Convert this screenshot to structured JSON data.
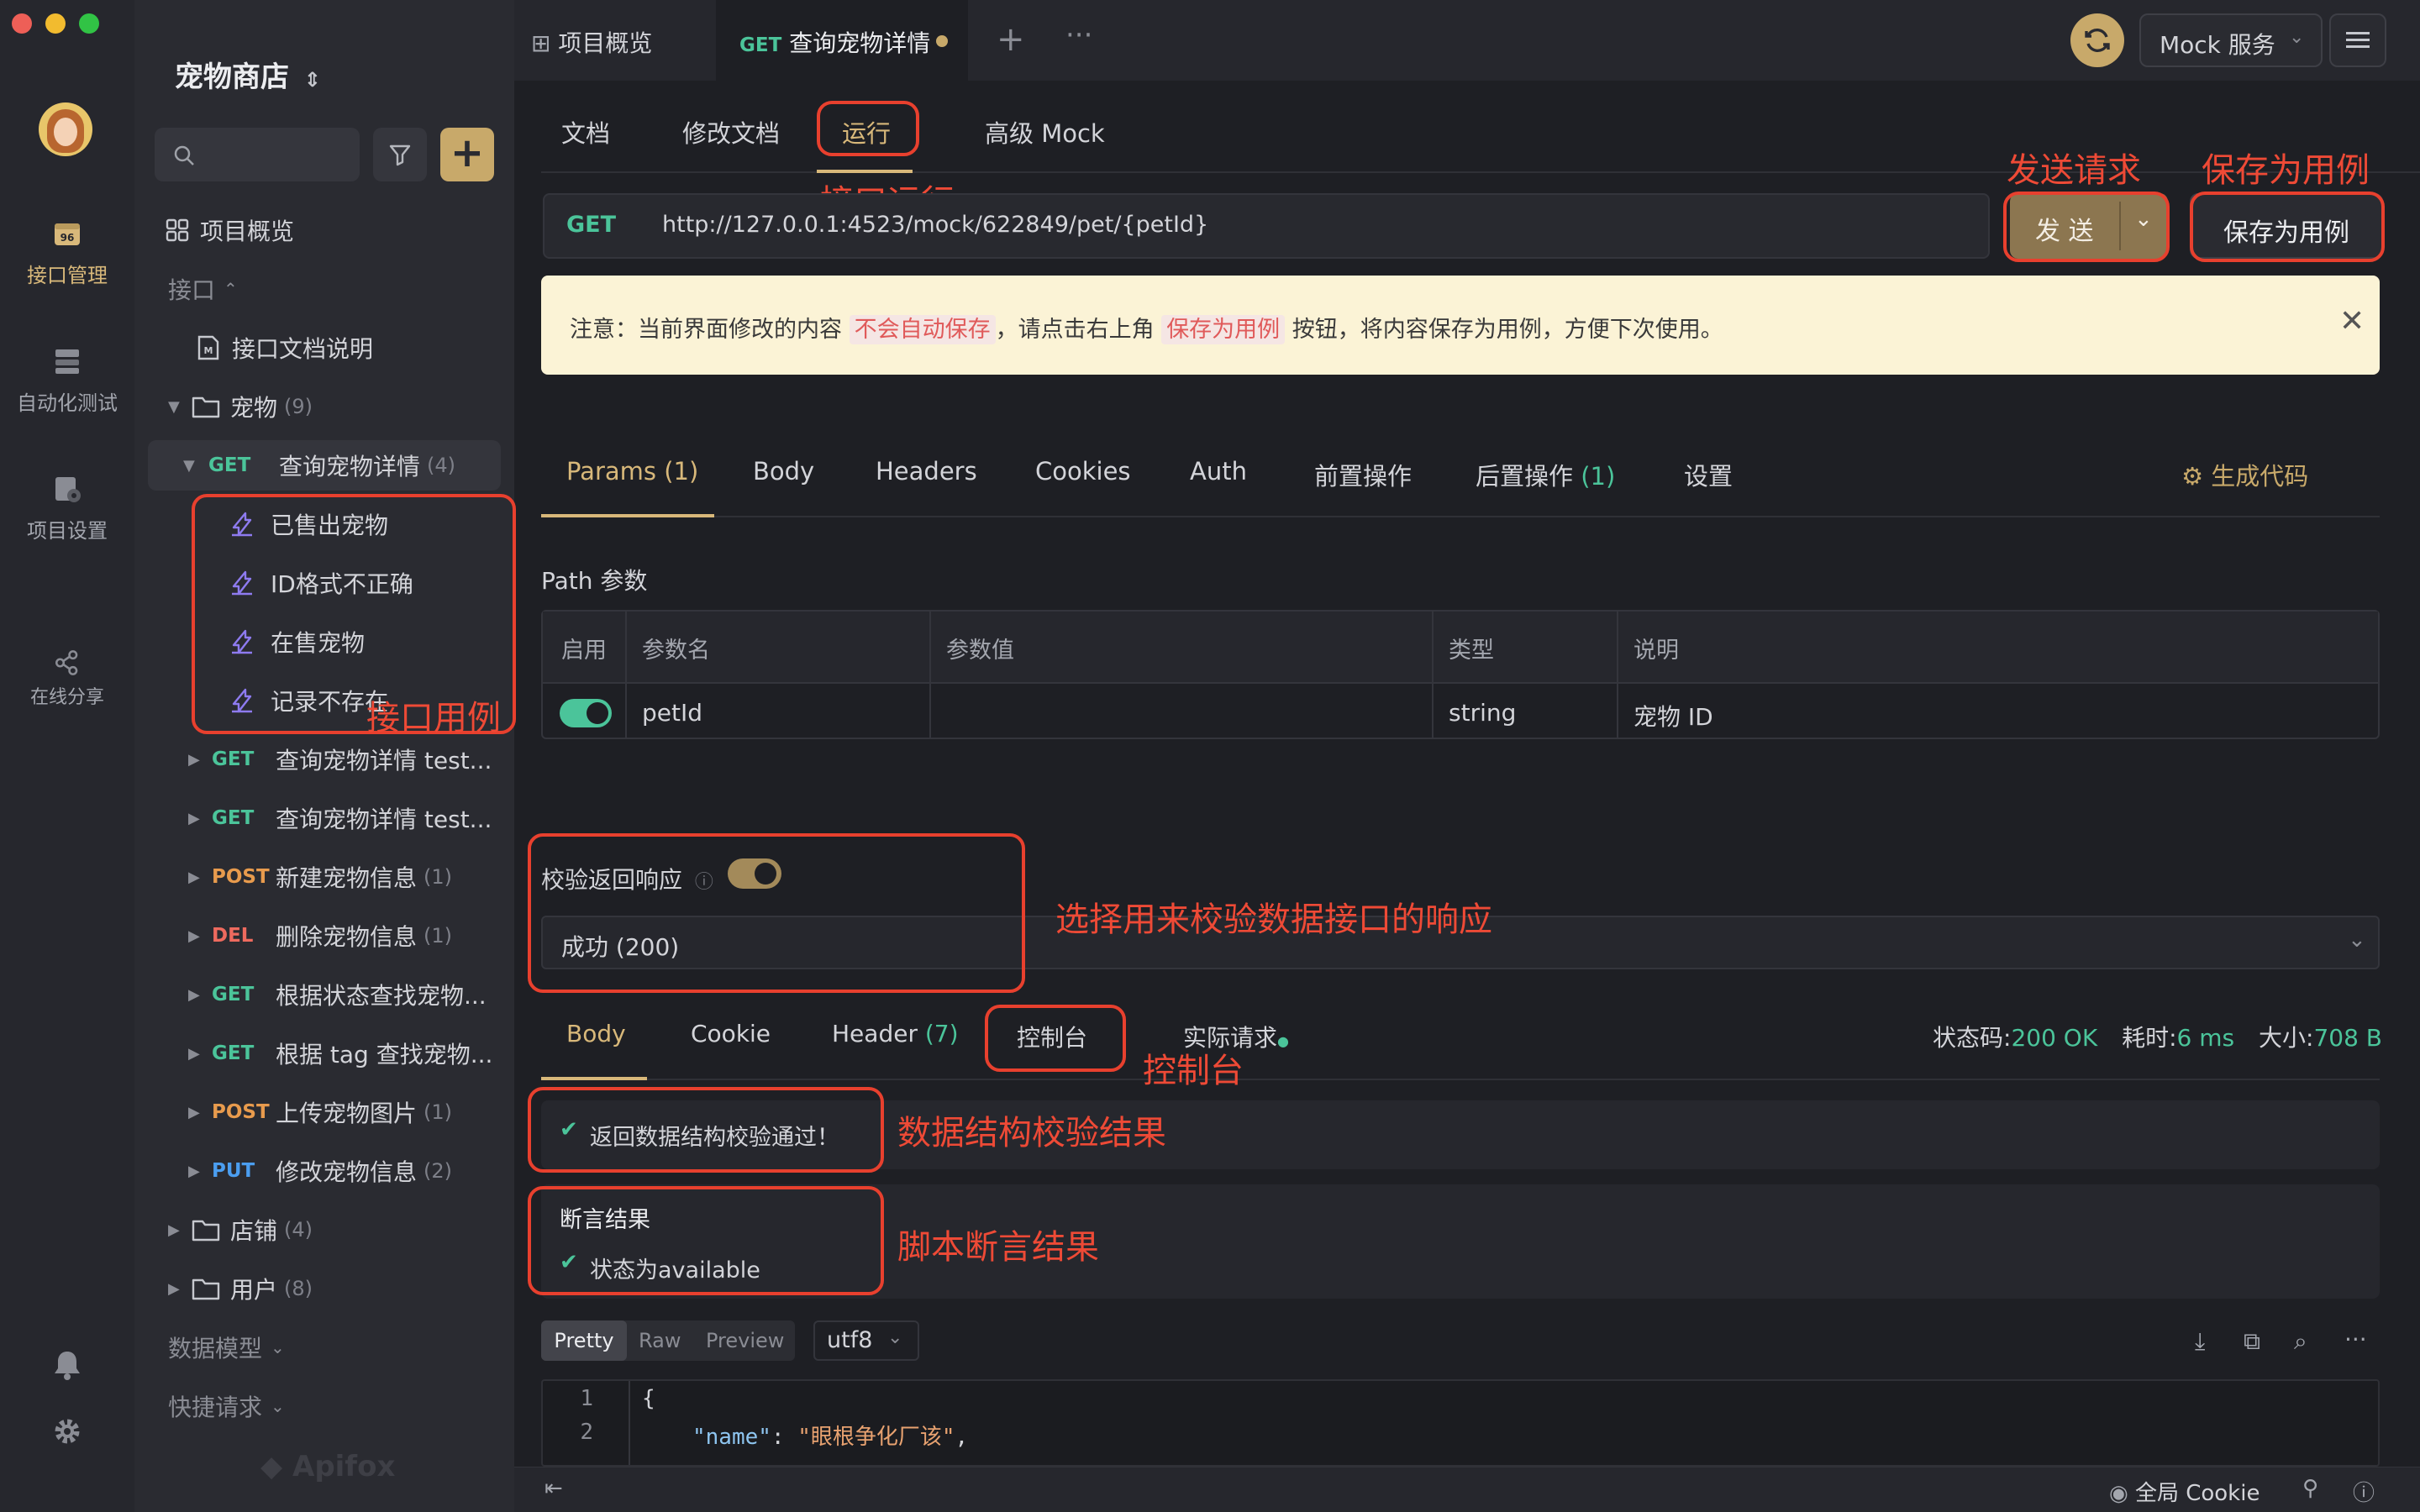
{
  "app": {
    "project_name": "宠物商店",
    "watermark": "Apifox"
  },
  "rail": {
    "items": [
      {
        "label": "接口管理",
        "icon": "api-management-icon"
      },
      {
        "label": "自动化测试",
        "icon": "automation-test-icon"
      },
      {
        "label": "项目设置",
        "icon": "project-settings-icon"
      },
      {
        "label": "在线分享",
        "icon": "share-icon"
      }
    ]
  },
  "sidebar": {
    "overview": "项目概览",
    "interfaces_label": "接口",
    "doc_note": "接口文档说明",
    "folder_pets": {
      "name": "宠物",
      "count": "(9)"
    },
    "selected": {
      "method": "GET",
      "name": "查询宠物详情",
      "count": "(4)"
    },
    "cases": [
      "已售出宠物",
      "ID格式不正确",
      "在售宠物",
      "记录不存在"
    ],
    "endpoints": [
      {
        "method": "GET",
        "name": "查询宠物详情 test...",
        "count": ""
      },
      {
        "method": "GET",
        "name": "查询宠物详情 test...",
        "count": ""
      },
      {
        "method": "POST",
        "name": "新建宠物信息",
        "count": "(1)"
      },
      {
        "method": "DEL",
        "name": "删除宠物信息",
        "count": "(1)"
      },
      {
        "method": "GET",
        "name": "根据状态查找宠物...",
        "count": ""
      },
      {
        "method": "GET",
        "name": "根据 tag 查找宠物...",
        "count": ""
      },
      {
        "method": "POST",
        "name": "上传宠物图片",
        "count": "(1)"
      },
      {
        "method": "PUT",
        "name": "修改宠物信息",
        "count": "(2)"
      }
    ],
    "folder_shops": {
      "name": "店铺",
      "count": "(4)"
    },
    "folder_users": {
      "name": "用户",
      "count": "(8)"
    },
    "data_model": "数据模型",
    "quick_request": "快捷请求"
  },
  "tabbar": {
    "tab1": "项目概览",
    "tab2_method": "GET",
    "tab2_name": "查询宠物详情",
    "mock_service": "Mock 服务"
  },
  "subtabs": [
    "文档",
    "修改文档",
    "运行",
    "高级 Mock"
  ],
  "request": {
    "method": "GET",
    "url": "http://127.0.0.1:4523/mock/622849/pet/{petId}",
    "send": "发 送",
    "save_case": "保存为用例"
  },
  "notice": {
    "prefix": "注意：当前界面修改的内容",
    "hl1": "不会自动保存",
    "mid": "，请点击右上角",
    "hl2": "保存为用例",
    "suffix": "按钮，将内容保存为用例，方便下次使用。"
  },
  "param_tabs": {
    "params": "Params",
    "params_count": "(1)",
    "body": "Body",
    "headers": "Headers",
    "cookies": "Cookies",
    "auth": "Auth",
    "pre": "前置操作",
    "post": "后置操作",
    "post_count": "(1)",
    "settings": "设置",
    "gen_code": "生成代码"
  },
  "path_params": {
    "title": "Path 参数",
    "headers": [
      "启用",
      "参数名",
      "参数值",
      "类型",
      "说明"
    ],
    "row": {
      "name": "petId",
      "value": "",
      "type": "string",
      "desc": "宠物 ID"
    }
  },
  "validate": {
    "label": "校验返回响应",
    "response_option": "成功 (200)"
  },
  "response_tabs": {
    "body": "Body",
    "cookie": "Cookie",
    "header": "Header",
    "header_count": "(7)",
    "console": "控制台",
    "actual": "实际请求",
    "status_label": "状态码:",
    "status_value": "200 OK",
    "time_label": "耗时:",
    "time_value": "6 ms",
    "size_label": "大小:",
    "size_value": "708 B"
  },
  "results": {
    "schema_pass": "返回数据结构校验通过！",
    "assert_title": "断言结果",
    "assert_item": "状态为available"
  },
  "viewer": {
    "modes": [
      "Pretty",
      "Raw",
      "Preview"
    ],
    "encoding": "utf8",
    "lines": [
      {
        "n": "1",
        "text": "{"
      },
      {
        "n": "2",
        "key": "\"name\"",
        "colon": ": ",
        "value": "\"眼根争化厂该\"",
        "comma": ","
      }
    ]
  },
  "footer": {
    "cookie": "全局 Cookie"
  },
  "annotations": {
    "run": "接口运行",
    "send": "发送请求",
    "save": "保存为用例",
    "cases": "接口用例",
    "validate": "选择用来校验数据接口的响应",
    "console": "控制台",
    "schema": "数据结构校验结果",
    "assert": "脚本断言结果"
  },
  "colors": {
    "accent_gold": "#d8b87a",
    "get": "#4bc49a",
    "post": "#e89b4d",
    "delete": "#ee6a5e",
    "put": "#4b9ef0",
    "annotation_red": "#e8402e"
  }
}
